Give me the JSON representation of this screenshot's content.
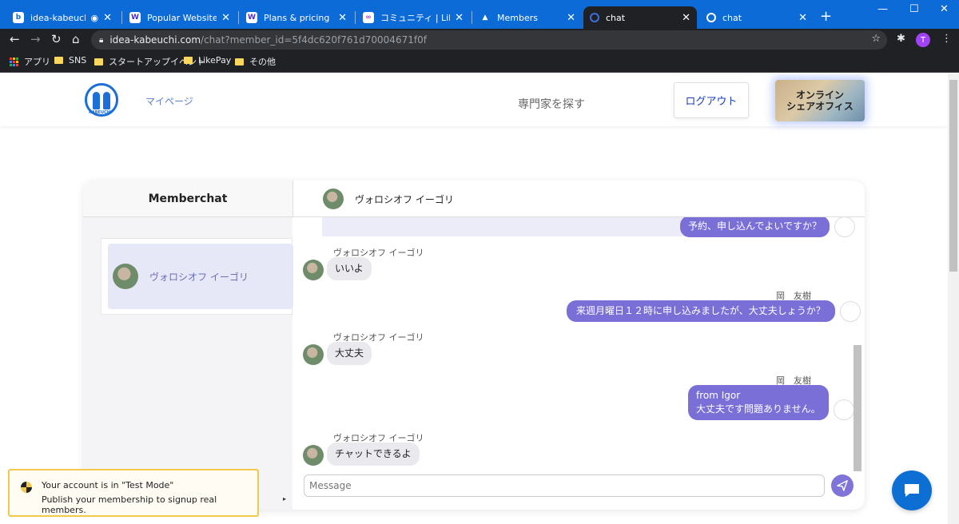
{
  "browser": {
    "tabs": [
      {
        "title": "idea-kabeuchi",
        "favicon": "idea-kabeuchi-icon"
      },
      {
        "title": "Popular Websites - W",
        "favicon": "wix-icon"
      },
      {
        "title": "Plans & pricing | Web",
        "favicon": "wix-icon"
      },
      {
        "title": "コミュニティ | LikePay.d",
        "favicon": "likepay-icon"
      },
      {
        "title": "Members",
        "favicon": "members-icon"
      },
      {
        "title": "chat",
        "favicon": "kabeuchi-icon",
        "active": true
      },
      {
        "title": "chat",
        "favicon": "kabeuchi-icon"
      }
    ],
    "url_host": "idea-kabeuchi.com",
    "url_path": "/chat?member_id=5f4dc620f761d70004671f0f",
    "profile_initial": "T",
    "bookmarks": [
      "アプリ",
      "SNS",
      "スタートアップイベント",
      "LikePay",
      "その他"
    ]
  },
  "header": {
    "mypage": "マイページ",
    "find_experts": "専門家を探す",
    "logout": "ログアウト",
    "office_banner": [
      "オンライン",
      "シェアオフィス"
    ],
    "logo_text": "KABEUCHI"
  },
  "chat": {
    "panel_title": "Memberchat",
    "partner_name": "ヴォロシオフ イーゴリ",
    "members": [
      {
        "name": "ヴォロシオフ イーゴリ"
      }
    ],
    "messages": [
      {
        "from": "me",
        "sender": "",
        "lines": [
          "予約、申し込んでよいですか？"
        ]
      },
      {
        "from": "partner",
        "sender": "ヴォロシオフ イーゴリ",
        "lines": [
          "いいよ"
        ]
      },
      {
        "from": "me",
        "sender": "岡　友樹",
        "lines": [
          "来週月曜日１２時に申し込みましたが、大丈夫しょうか？"
        ]
      },
      {
        "from": "partner",
        "sender": "ヴォロシオフ イーゴリ",
        "lines": [
          "大丈夫"
        ]
      },
      {
        "from": "me",
        "sender": "岡　友樹",
        "lines": [
          "from Igor",
          "大丈夫です問題ありません。"
        ]
      },
      {
        "from": "partner",
        "sender": "ヴォロシオフ イーゴリ",
        "lines": [
          "チャットできるよ"
        ]
      }
    ],
    "composer_placeholder": "Message"
  },
  "toast": {
    "title": "Your account is in \"Test Mode\"",
    "body": "Publish your membership to signup real members."
  },
  "colors": {
    "accent": "#7a6fd6",
    "browser_blue": "#0c6bd6",
    "fab": "#0d6fd4"
  }
}
